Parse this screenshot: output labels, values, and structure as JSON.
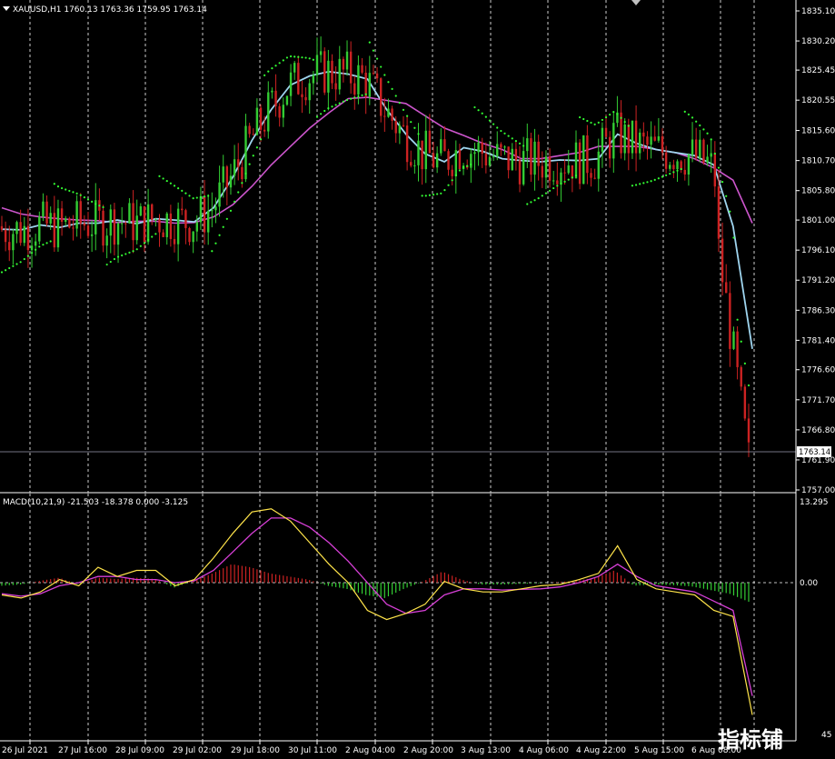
{
  "main": {
    "header": "XAUUSD,H1  1760.13 1763.36 1759.95 1763.14",
    "current_price": "1763.14",
    "price_labels": [
      "1835.10",
      "1830.20",
      "1825.45",
      "1820.55",
      "1815.60",
      "1810.70",
      "1805.80",
      "1801.00",
      "1796.10",
      "1791.20",
      "1786.30",
      "1781.40",
      "1776.60",
      "1771.70",
      "1766.80",
      "1761.90",
      "1757.00"
    ]
  },
  "macd": {
    "header": "MACD(10,21,9) -21.503 -18.378 0.000 -3.125",
    "labels": [
      "13.295",
      "0.00"
    ],
    "bottom_label": "45"
  },
  "time_axis": {
    "labels": [
      "26 Jul 2021",
      "27 Jul 16:00",
      "28 Jul 09:00",
      "29 Jul 02:00",
      "29 Jul 18:00",
      "30 Jul 11:00",
      "2 Aug 04:00",
      "2 Aug 20:00",
      "3 Aug 13:00",
      "4 Aug 06:00",
      "4 Aug 22:00",
      "5 Aug 15:00",
      "6 Aug 08:00"
    ]
  },
  "watermark": "指标铺",
  "colors": {
    "background": "#000000",
    "grid": "#ffffff",
    "bull": "#33cc33",
    "bear": "#cc2222",
    "sar": "#33ff33",
    "ma_fast": "#9fd5ef",
    "ma_slow": "#cc55cc",
    "macd_line": "#ffe44a",
    "signal_line": "#d63fd6"
  },
  "chart_data": {
    "type": "candlestick",
    "price_range": [
      1757.0,
      1835.1
    ],
    "ma_fast": [
      1799.5,
      1799.4,
      1800.2,
      1799.8,
      1800.5,
      1800.5,
      1801.0,
      1800.4,
      1801.2,
      1801.0,
      1800.7,
      1803.0,
      1808.0,
      1814.0,
      1819.0,
      1823.0,
      1824.5,
      1825.2,
      1824.8,
      1824.0,
      1819.0,
      1815.0,
      1811.8,
      1810.5,
      1812.8,
      1812.2,
      1811.0,
      1810.7,
      1810.5,
      1810.8,
      1810.7,
      1811.0,
      1815.0,
      1813.5,
      1812.5,
      1812.0,
      1811.5,
      1810.0,
      1800.0,
      1780.0
    ],
    "ma_slow": [
      1803.0,
      1802.0,
      1801.5,
      1801.2,
      1801.0,
      1800.9,
      1800.6,
      1800.8,
      1800.8,
      1800.5,
      1800.6,
      1801.5,
      1803.5,
      1806.5,
      1810.0,
      1813.0,
      1816.0,
      1818.5,
      1820.8,
      1821.0,
      1820.5,
      1820.0,
      1818.0,
      1816.0,
      1814.8,
      1813.5,
      1812.5,
      1811.0,
      1811.0,
      1811.5,
      1812.0,
      1813.0,
      1813.0,
      1813.0,
      1812.5,
      1812.0,
      1811.0,
      1809.5,
      1807.5,
      1800.5
    ],
    "macd_line": [
      -2.0,
      -2.5,
      -1.5,
      0.5,
      -0.5,
      2.5,
      1.0,
      2.0,
      2.0,
      -0.5,
      0.5,
      4.0,
      8.0,
      11.5,
      12.0,
      10.0,
      6.5,
      3.0,
      0.0,
      -4.5,
      -6.0,
      -5.0,
      -3.5,
      0.2,
      -1.0,
      -1.5,
      -1.5,
      -1.0,
      -0.5,
      -0.3,
      0.5,
      1.5,
      6.0,
      0.5,
      -1.0,
      -1.5,
      -2.0,
      -4.5,
      -5.5,
      -21.5
    ],
    "signal_line": [
      -1.8,
      -2.2,
      -1.8,
      -0.5,
      0.0,
      1.0,
      1.0,
      0.5,
      0.5,
      0.0,
      0.3,
      2.0,
      5.0,
      8.0,
      10.5,
      10.5,
      9.0,
      6.5,
      3.5,
      0.0,
      -3.5,
      -5.0,
      -4.5,
      -2.0,
      -1.0,
      -1.0,
      -1.2,
      -1.1,
      -1.0,
      -0.7,
      0.0,
      1.0,
      3.0,
      1.0,
      -0.5,
      -1.0,
      -1.5,
      -3.0,
      -4.5,
      -18.4
    ],
    "histogram": [
      -0.5,
      -0.3,
      0.3,
      0.8,
      -0.3,
      0.8,
      0.6,
      0.8,
      0.6,
      -0.8,
      0.3,
      1.5,
      3.0,
      2.5,
      1.5,
      1.0,
      0.5,
      -0.5,
      -1.0,
      -2.0,
      -2.5,
      -1.0,
      0.2,
      1.8,
      0.5,
      -0.3,
      -0.3,
      -0.2,
      -0.1,
      0.1,
      0.3,
      0.8,
      2.0,
      -0.5,
      -0.3,
      -0.4,
      -0.6,
      -1.2,
      -1.8,
      -3.1
    ],
    "macd_range": [
      -21.5,
      13.295
    ]
  }
}
